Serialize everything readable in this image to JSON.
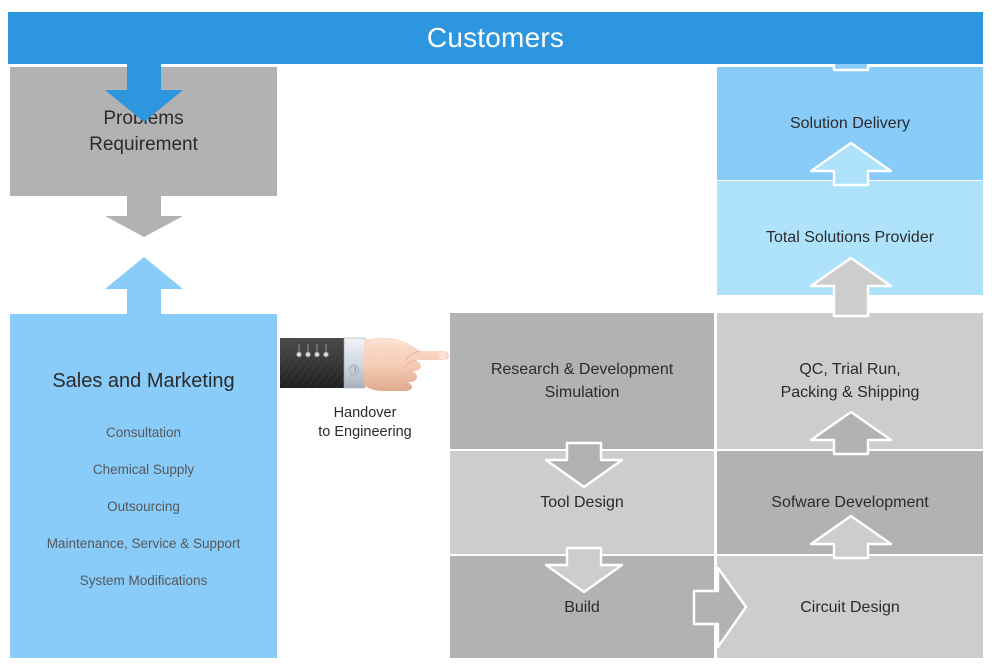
{
  "diagram": {
    "title": "Customers",
    "header": {
      "label": "Customers",
      "bg": "#2e96de",
      "text_color": "#ffffff"
    },
    "left_column": {
      "problems": {
        "line1": "Problems",
        "line2": "Requirement",
        "bg": "#b2b2b2"
      },
      "sales": {
        "title": "Sales and Marketing",
        "bg": "#89cbf9",
        "items": [
          {
            "label": "Consultation"
          },
          {
            "label": "Chemical Supply"
          },
          {
            "label": "Outsourcing"
          },
          {
            "label": "Maintenance, Service & Support"
          },
          {
            "label": "System Modifications"
          }
        ]
      }
    },
    "handover": {
      "line1": "Handover",
      "line2": "to Engineering",
      "icon": "pointing-hand-icon"
    },
    "right_column": {
      "solution_delivery": {
        "label": "Solution Delivery",
        "bg": "#89cbf9"
      },
      "total_solutions": {
        "label": "Total Solutions Provider",
        "bg": "#aee3fb"
      }
    },
    "process_grid": {
      "cells": [
        {
          "key": "rnd",
          "line1": "Research & Development",
          "line2": "Simulation",
          "bg": "#b2b2b2"
        },
        {
          "key": "qc",
          "line1": "QC, Trial Run,",
          "line2": "Packing & Shipping",
          "bg": "#cdcdcd"
        },
        {
          "key": "tool",
          "line1": "Tool Design",
          "line2": "",
          "bg": "#cdcdcd"
        },
        {
          "key": "software",
          "line1": "Sofware Development",
          "line2": "",
          "bg": "#b2b2b2"
        },
        {
          "key": "build",
          "line1": "Build",
          "line2": "",
          "bg": "#b2b2b2"
        },
        {
          "key": "circuit",
          "line1": "Circuit Design",
          "line2": "",
          "bg": "#cdcdcd"
        }
      ]
    },
    "arrows": [
      {
        "name": "customers-to-problems",
        "direction": "down",
        "color": "#2e96de"
      },
      {
        "name": "problems-to-gap",
        "direction": "down",
        "color": "#b2b2b2"
      },
      {
        "name": "sales-to-problems",
        "direction": "up",
        "color": "#89cbf9"
      },
      {
        "name": "solution-to-customers",
        "direction": "up",
        "color": "#89cbf9"
      },
      {
        "name": "total-to-solution",
        "direction": "up",
        "color": "#aee3fb"
      },
      {
        "name": "qc-to-total",
        "direction": "up",
        "color": "#cdcdcd"
      },
      {
        "name": "rnd-to-tool",
        "direction": "down",
        "color": "#b2b2b2"
      },
      {
        "name": "tool-to-build",
        "direction": "down",
        "color": "#cdcdcd"
      },
      {
        "name": "build-to-circuit",
        "direction": "right",
        "color": "#b2b2b2"
      },
      {
        "name": "circuit-to-software",
        "direction": "up",
        "color": "#cdcdcd"
      },
      {
        "name": "software-to-qc",
        "direction": "up",
        "color": "#b2b2b2"
      }
    ],
    "palette": {
      "brand_blue": "#2e96de",
      "light_blue": "#89cbf9",
      "pale_blue": "#aee3fb",
      "mid_gray": "#b2b2b2",
      "light_gray": "#cdcdcd",
      "text": "#2b2b2b"
    }
  }
}
